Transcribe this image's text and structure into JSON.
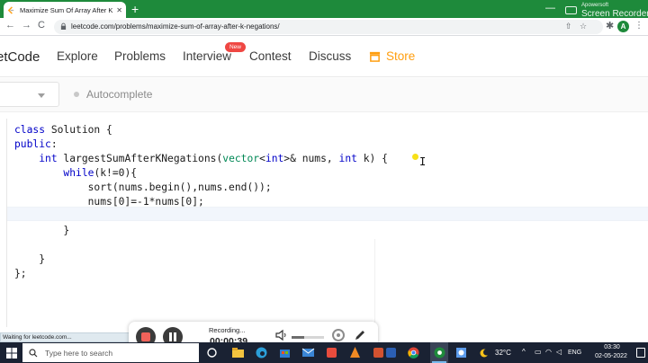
{
  "browser": {
    "tab_title": "Maximize Sum Of Array After K N",
    "url": "leetcode.com/problems/maximize-sum-of-array-after-k-negations/",
    "nav_back": "←",
    "nav_forward": "→",
    "nav_reload": "C",
    "window_min": "—",
    "window_close": "✕",
    "new_tab": "+",
    "tab_close": "✕",
    "profile_initial": "A",
    "menu": "⋮",
    "share_glyph": "⇧",
    "star_glyph": "☆",
    "ext_glyph": "✱"
  },
  "watermark": {
    "line1": "Apowersoft",
    "line2": "Screen Recorder"
  },
  "leetcode_nav": {
    "logo": "etCode",
    "items": [
      "Explore",
      "Problems",
      "Interview",
      "Contest",
      "Discuss",
      "Store"
    ],
    "new_badge": "New"
  },
  "editor_toolbar": {
    "autocomplete_label": "Autocomplete"
  },
  "code_lines": [
    "class Solution {",
    "public:",
    "    int largestSumAfterKNegations(vector<int>& nums, int k) {",
    "        while(k!=0){",
    "            sort(nums.begin(),nums.end());",
    "            nums[0]=-1*nums[0];",
    "",
    "        }",
    "",
    "    }",
    "};"
  ],
  "status_text": "Waiting for leetcode.com...",
  "recorder": {
    "label": "Recording...",
    "time": "00:00:39",
    "level": 0.4
  },
  "taskbar": {
    "search_placeholder": "Type here to search",
    "temperature": "32°C",
    "tray_chevron": "^",
    "language": "ENG",
    "time": "03:30",
    "date": "02-05-2022"
  },
  "colors": {
    "chrome_green": "#1e8a3b",
    "store_orange": "#ff9e0f",
    "keyword_blue": "#0000c8",
    "type_green": "#008855",
    "badge_red": "#ef4743"
  }
}
